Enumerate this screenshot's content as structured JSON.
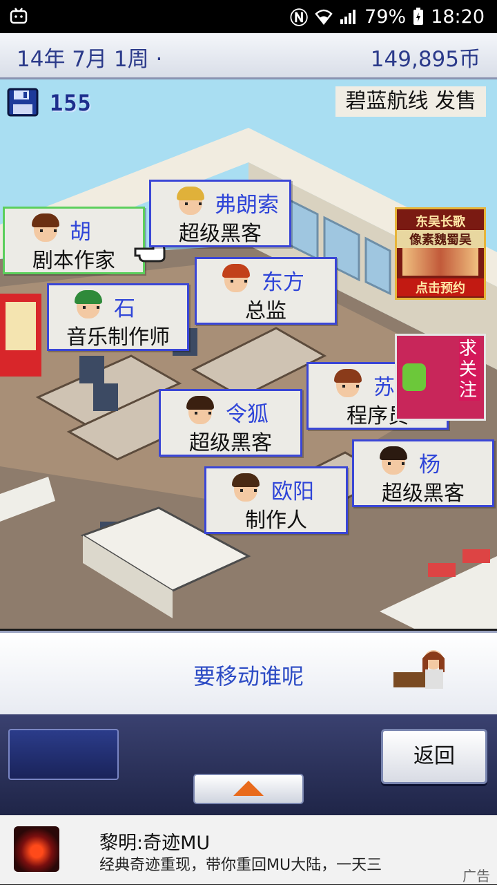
{
  "status_bar": {
    "battery": "79%",
    "time": "18:20"
  },
  "header": {
    "date": "14年 7月 1周 ·",
    "money": "149,895币"
  },
  "hud": {
    "points": "155",
    "release": "碧蓝航线 发售"
  },
  "staff": [
    {
      "name": "胡",
      "role": "剧本作家",
      "selected": true,
      "hair": "#6b2f12"
    },
    {
      "name": "弗朗索",
      "role": "超级黑客",
      "selected": false,
      "hair": "#e0b13a"
    },
    {
      "name": "东方",
      "role": "总监",
      "selected": false,
      "hair": "#c2401a"
    },
    {
      "name": "石",
      "role": "音乐制作师",
      "selected": false,
      "hair": "#2f8a3a"
    },
    {
      "name": "苏",
      "role": "程序员",
      "selected": false,
      "hair": "#8a3b1a"
    },
    {
      "name": "令狐",
      "role": "超级黑客",
      "selected": false,
      "hair": "#3a2010"
    },
    {
      "name": "杨",
      "role": "超级黑客",
      "selected": false,
      "hair": "#2b1a10"
    },
    {
      "name": "欧阳",
      "role": "制作人",
      "selected": false,
      "hair": "#4a2a14"
    }
  ],
  "game_ad": {
    "line1": "东吴长歌",
    "line2": "像素魏蜀吴",
    "cta": "点击预约"
  },
  "follow_badge": "求关注",
  "message": "要移动谁呢",
  "controls": {
    "back": "返回"
  },
  "ad": {
    "title": "黎明:奇迹MU",
    "desc": "经典奇迹重现，带你重回MU大陆，一天三",
    "tag": "广告"
  }
}
